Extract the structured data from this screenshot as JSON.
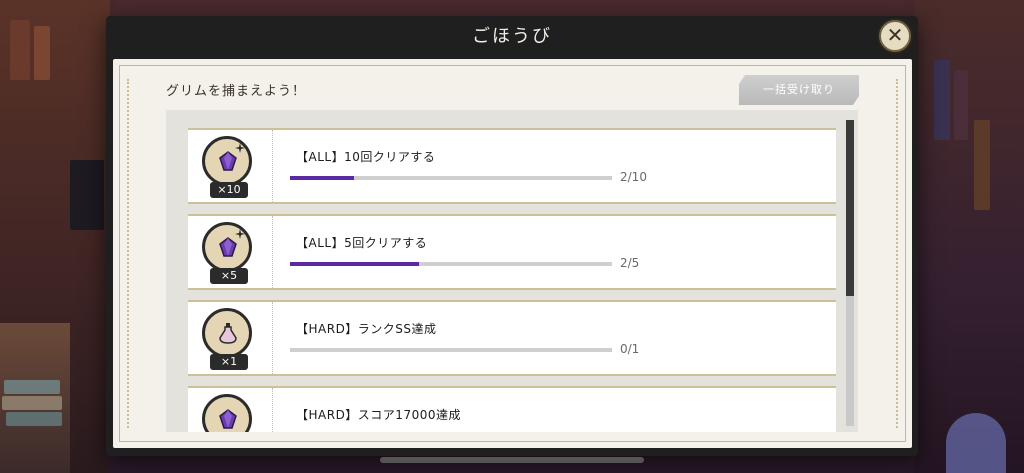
{
  "modal": {
    "title": "ごほうび",
    "close_label": "✕"
  },
  "panel": {
    "section_title": "グリムを捕まえよう！",
    "claim_all_label": "一括受け取り"
  },
  "missions": [
    {
      "title": "【ALL】10回クリアする",
      "quantity": "×10",
      "icon": "gem-icon",
      "current": 2,
      "target": 10,
      "progress_text": "2/10"
    },
    {
      "title": "【ALL】5回クリアする",
      "quantity": "×5",
      "icon": "gem-icon",
      "current": 2,
      "target": 5,
      "progress_text": "2/5"
    },
    {
      "title": "【HARD】ランクSS達成",
      "quantity": "×1",
      "icon": "potion-icon",
      "current": 0,
      "target": 1,
      "progress_text": "0/1"
    },
    {
      "title": "【HARD】スコア17000達成",
      "quantity": "",
      "icon": "gem-icon",
      "current": null,
      "target": null,
      "progress_text": ""
    }
  ],
  "colors": {
    "progress_fill": "#5b2aa0",
    "gem": "#6b3bb0",
    "potion": "#e7c7dc",
    "medal": "#e4d6b5"
  }
}
